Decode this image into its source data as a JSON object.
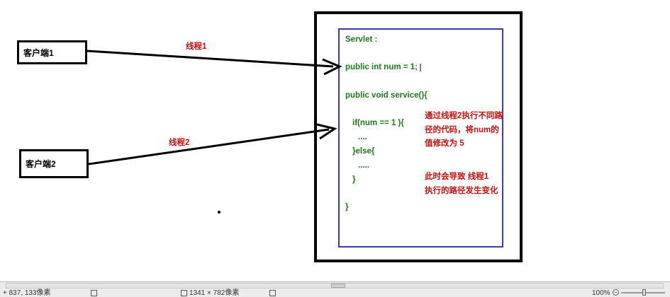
{
  "diagram": {
    "client1": "客户端1",
    "client2": "客户端2",
    "thread1_label": "线程1",
    "thread2_label": "线程2",
    "code_lines": [
      "Servlet :",
      "public int num = 1;",
      "public void service(){",
      "if(num == 1 ){",
      "....",
      "}else{",
      ".....",
      "}",
      "}"
    ],
    "note1": [
      "通过线程2执行不同路",
      "径的代码，将num的",
      "值修改为 5"
    ],
    "note2": [
      "此时会导致 线程1",
      "执行的路径发生变化"
    ]
  },
  "statusbar": {
    "coords": "837, 133像素",
    "dimensions": "1341 × 782像素",
    "zoom": "100%"
  },
  "colors": {
    "code": "#1b7a1b",
    "annotation": "#c81010",
    "inner_border": "#3a3aa8"
  }
}
